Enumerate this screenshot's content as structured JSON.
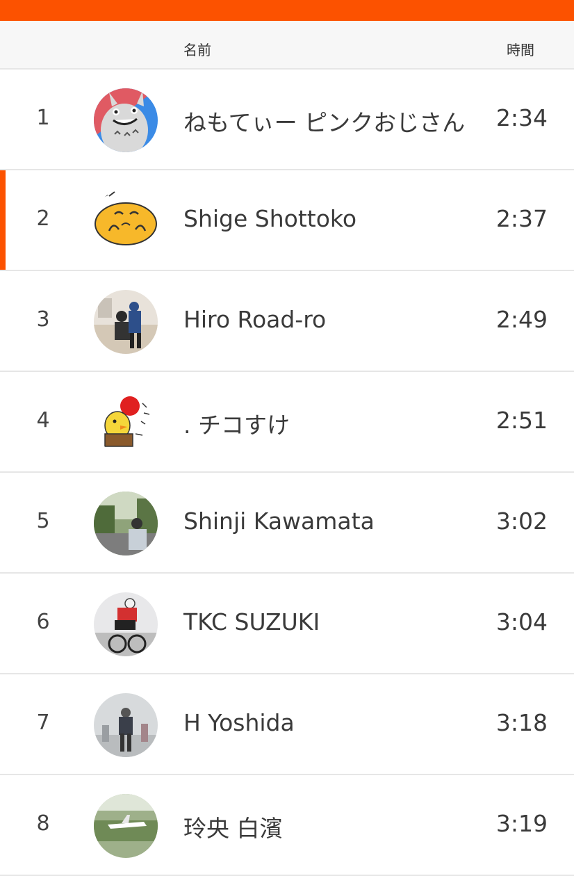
{
  "header": {
    "name_col": "名前",
    "time_col": "時間"
  },
  "colors": {
    "accent": "#fc5200",
    "header_bg": "#f7f7f7",
    "divider": "#e6e6e6",
    "text": "#3a3a3a"
  },
  "rows": [
    {
      "rank": "1",
      "name": "ねもてぃー ピンクおじさん",
      "time": "2:34",
      "avatar": "totoro-avatar"
    },
    {
      "rank": "2",
      "name": "Shige Shottoko",
      "time": "2:37",
      "avatar": "egg-character-avatar",
      "highlighted": true
    },
    {
      "rank": "3",
      "name": "Hiro Road-ro",
      "time": "2:49",
      "avatar": "cyclist-photo-avatar"
    },
    {
      "rank": "4",
      "name": ". チコすけ",
      "time": "2:51",
      "avatar": "chick-character-avatar"
    },
    {
      "rank": "5",
      "name": "Shinji Kawamata",
      "time": "3:02",
      "avatar": "street-photo-avatar"
    },
    {
      "rank": "6",
      "name": "TKC SUZUKI",
      "time": "3:04",
      "avatar": "cyclist-race-avatar"
    },
    {
      "rank": "7",
      "name": "H Yoshida",
      "time": "3:18",
      "avatar": "cyclist-fog-avatar"
    },
    {
      "rank": "8",
      "name": "玲央 白濱",
      "time": "3:19",
      "avatar": "airplane-photo-avatar"
    }
  ]
}
